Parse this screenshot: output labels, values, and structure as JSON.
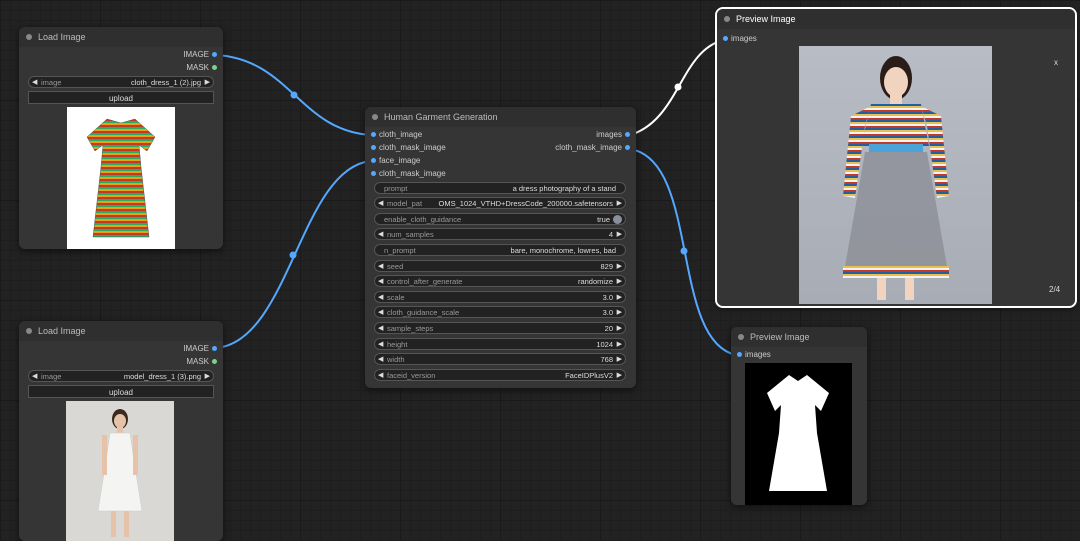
{
  "colors": {
    "link_blue": "#54a8ff",
    "link_white": "#ffffff",
    "slot_green": "#7bd389",
    "canvas": "#222222",
    "node": "#353535"
  },
  "load_image_1": {
    "title": "Load Image",
    "outputs": [
      "IMAGE",
      "MASK"
    ],
    "image_label": "image",
    "image_value": "cloth_dress_1 (2).jpg",
    "upload_label": "upload",
    "thumbnail": "colorful striped dress"
  },
  "load_image_2": {
    "title": "Load Image",
    "outputs": [
      "IMAGE",
      "MASK"
    ],
    "image_label": "image",
    "image_value": "model_dress_1 (3).png",
    "upload_label": "upload",
    "thumbnail": "woman in white dress"
  },
  "garment": {
    "title": "Human Garment Generation",
    "inputs": [
      "cloth_image",
      "cloth_mask_image",
      "face_image",
      "cloth_mask_image"
    ],
    "outputs": [
      "images",
      "cloth_mask_image"
    ],
    "widgets": [
      {
        "label": "prompt",
        "value": "a dress photography of a stand"
      },
      {
        "label": "model_pat",
        "value": "OMS_1024_VTHD+DressCode_200000.safetensors"
      },
      {
        "label": "enable_cloth_guidance",
        "value": "true"
      },
      {
        "label": "num_samples",
        "value": "4"
      },
      {
        "label": "n_prompt",
        "value": "bare, monochrome, lowres, bad"
      },
      {
        "label": "seed",
        "value": "829"
      },
      {
        "label": "control_after_generate",
        "value": "randomize"
      },
      {
        "label": "scale",
        "value": "3.0"
      },
      {
        "label": "cloth_guidance_scale",
        "value": "3.0"
      },
      {
        "label": "sample_steps",
        "value": "20"
      },
      {
        "label": "height",
        "value": "1024"
      },
      {
        "label": "width",
        "value": "768"
      },
      {
        "label": "faceid_version",
        "value": "FaceIDPlusV2"
      }
    ]
  },
  "preview_1": {
    "title": "Preview Image",
    "input": "images",
    "close": "x",
    "counter": "2/4",
    "image": "girl in striped dress"
  },
  "preview_2": {
    "title": "Preview Image",
    "input": "images",
    "image": "white dress mask silhouette"
  },
  "icons": {
    "left_arrow": "◀",
    "right_arrow": "▶"
  }
}
